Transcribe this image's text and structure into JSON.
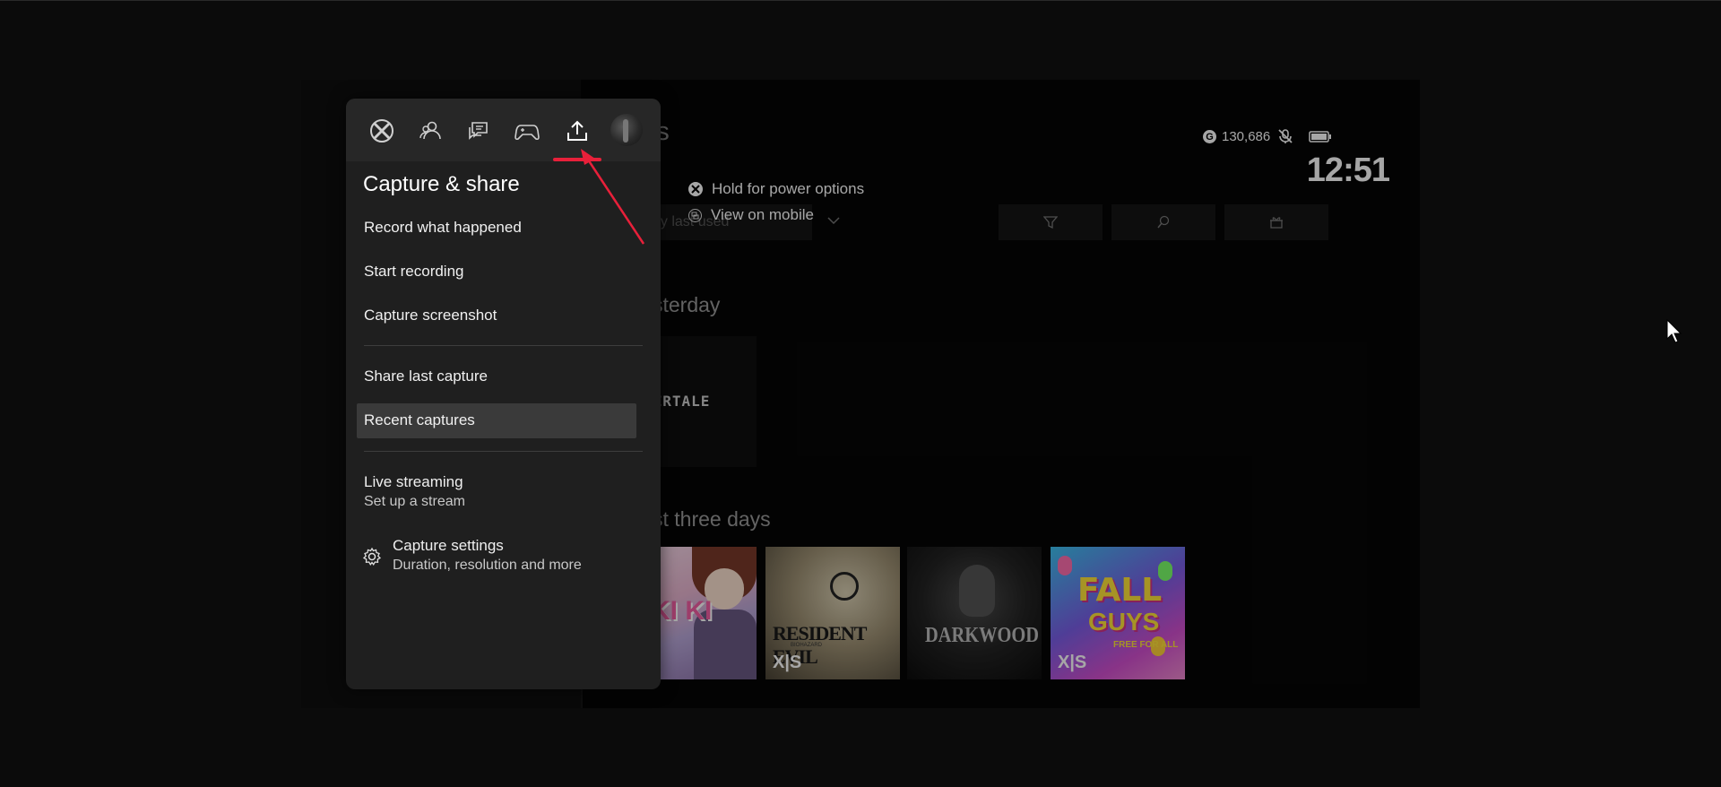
{
  "dashboard": {
    "title_partial": "mes",
    "gamerscore": "130,686",
    "gamerscore_icon": "G",
    "clock": "12:51",
    "sort_label": "by last used",
    "section_recent": "sterday",
    "section_last": "st three days",
    "tiles": {
      "undertale": "DERTALE",
      "ddlc": "KI KI",
      "re7_title": "RESIDENT EVIL",
      "re7_sub": "BIOHAZARD",
      "re7_badge": "X|S",
      "darkwood": "DARKWOOD",
      "fall_guys_1": "FALL",
      "fall_guys_2": "GUYS",
      "fall_guys_tag": "FREE FOR ALL",
      "fall_guys_badge": "X|S"
    }
  },
  "hints": {
    "power": "Hold for power options",
    "mobile": "View on mobile"
  },
  "guide": {
    "tabs": [
      {
        "name": "xbox-home",
        "icon": "xbox-logo-icon"
      },
      {
        "name": "people",
        "icon": "people-icon"
      },
      {
        "name": "parties-chats",
        "icon": "chat-icon"
      },
      {
        "name": "multiplayer",
        "icon": "controller-icon"
      },
      {
        "name": "capture-share",
        "icon": "share-upload-icon"
      },
      {
        "name": "profile",
        "icon": "avatar-icon"
      }
    ],
    "active_tab": "capture-share",
    "title": "Capture & share",
    "items": {
      "record": "Record what happened",
      "start_recording": "Start recording",
      "screenshot": "Capture screenshot",
      "share_last": "Share last capture",
      "recent": "Recent captures",
      "live_title": "Live streaming",
      "live_sub": "Set up a stream",
      "settings_title": "Capture settings",
      "settings_sub": "Duration, resolution and more"
    }
  },
  "colors": {
    "accent_red": "#e8203a",
    "panel_bg": "#1f1f1f",
    "highlight_bg": "#3a3a3a"
  }
}
